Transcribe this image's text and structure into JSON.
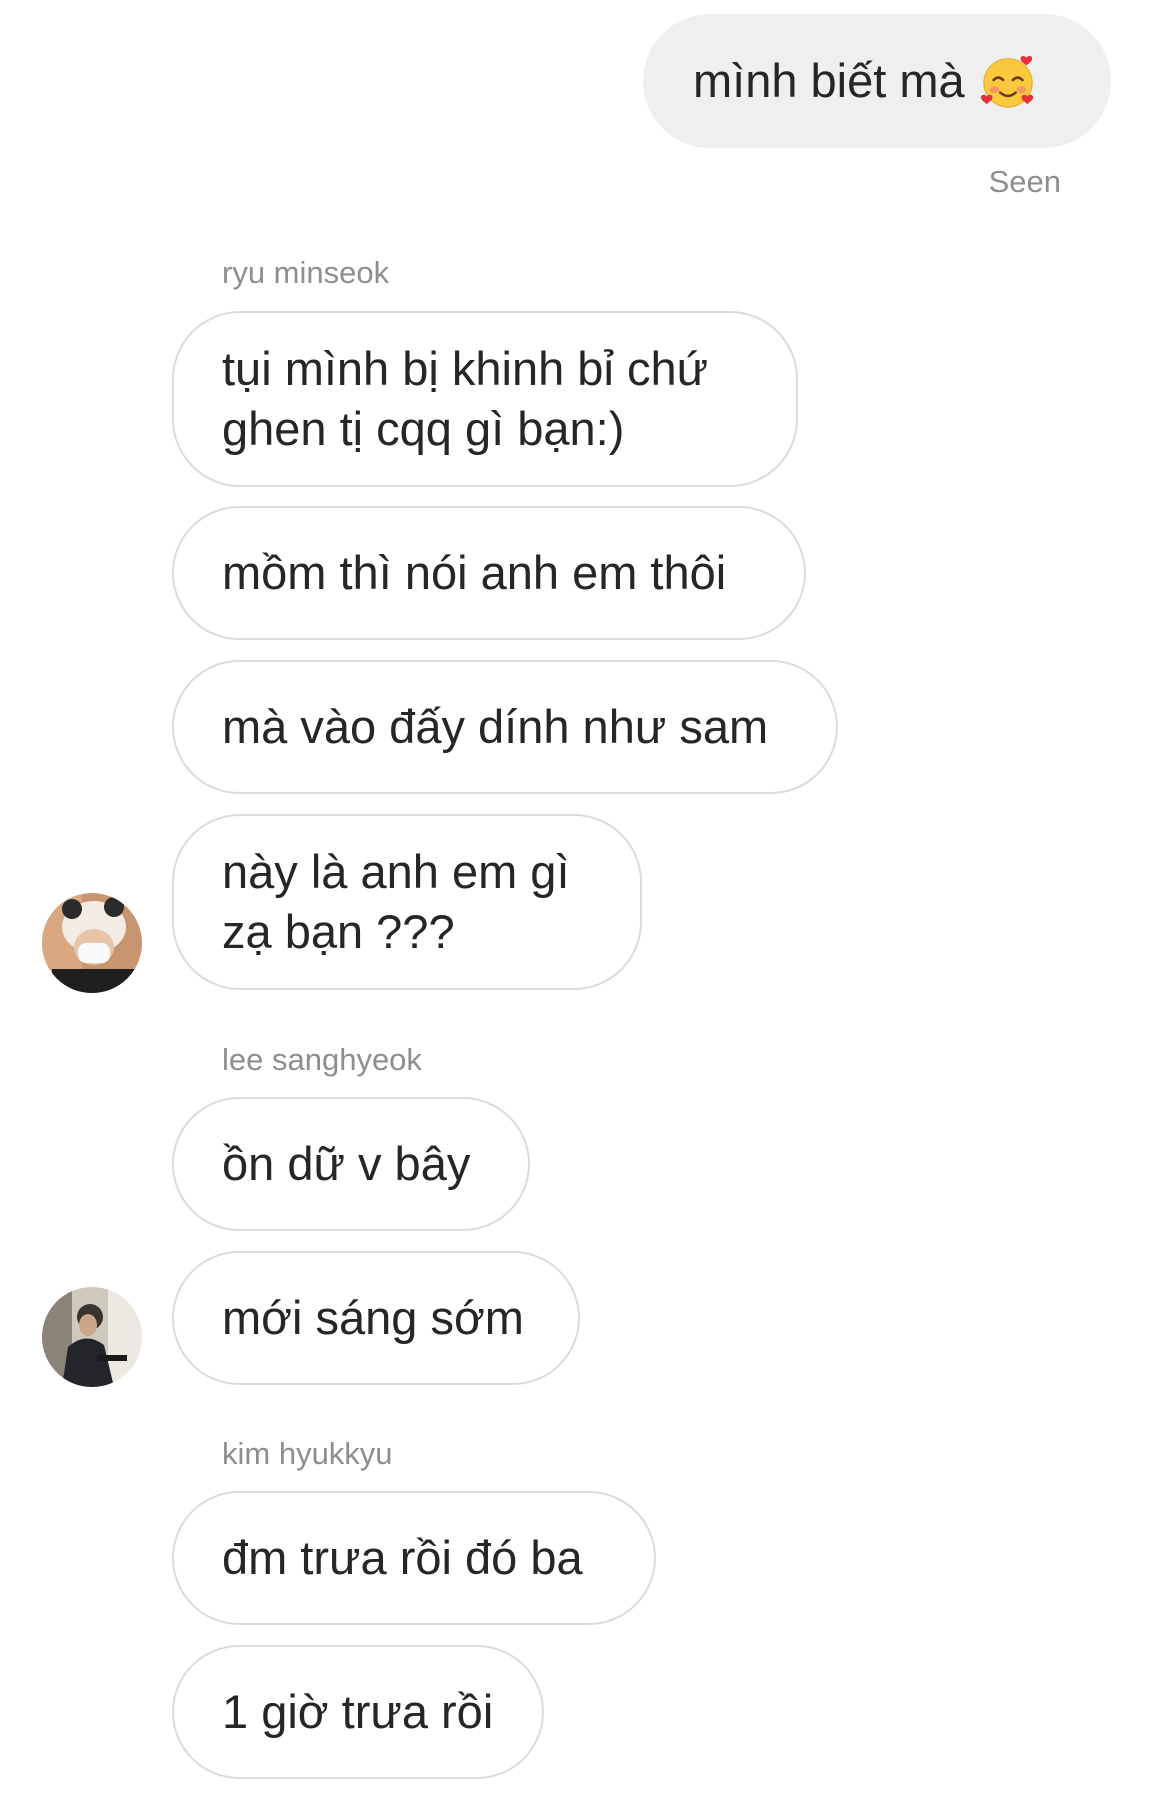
{
  "outgoing": {
    "text": "mình biết mà",
    "emoji": "smiling-face-with-hearts-icon",
    "status": "Seen"
  },
  "groups": [
    {
      "sender": "ryu minseok",
      "messages": [
        [
          "tụi mình bị khinh bỉ chứ",
          "ghen tị cqq gì bạn:)"
        ],
        [
          "mồm thì nói anh em thôi"
        ],
        [
          "mà vào đấy dính như sam"
        ],
        [
          "này là anh em gì",
          "zạ bạn ???"
        ]
      ]
    },
    {
      "sender": "lee sanghyeok",
      "messages": [
        [
          "ồn dữ v bây"
        ],
        [
          "mới sáng sớm"
        ]
      ]
    },
    {
      "sender": "kim hyukkyu",
      "messages": [
        [
          "đm trưa rồi đó ba"
        ],
        [
          "1 giờ trưa rồi"
        ]
      ]
    }
  ],
  "colors": {
    "outgoing_bubble": "#efefef",
    "incoming_border": "#dbdbdb",
    "meta_text": "#8e8e8e",
    "text": "#262626"
  }
}
